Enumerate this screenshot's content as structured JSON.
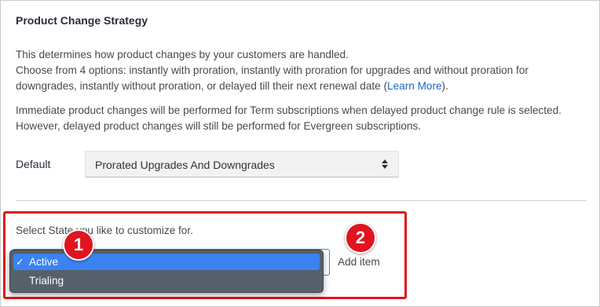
{
  "section": {
    "title": "Product Change Strategy",
    "description_line1": "This determines how product changes by your customers are handled.",
    "description_line2_pre": "Choose from 4 options: instantly with proration, instantly with proration for upgrades and without proration for downgrades, instantly without proration, or delayed till their next renewal date (",
    "learn_more": "Learn More",
    "description_line2_post": ").",
    "note": "Immediate product changes will be performed for Term subscriptions when delayed product change rule is selected. However, delayed product changes will still be performed for Evergreen subscriptions."
  },
  "default_field": {
    "label": "Default",
    "value": "Prorated Upgrades And Downgrades",
    "icon": "up-down-arrows-icon"
  },
  "state_customization": {
    "label": "Select State you like to customize for.",
    "add_item": "Add item",
    "dropdown": {
      "options": [
        {
          "label": "Active",
          "selected": true,
          "check": "✓"
        },
        {
          "label": "Trialing",
          "selected": false
        }
      ]
    }
  },
  "annotations": {
    "badge1": "1",
    "badge2": "2",
    "highlight_color": "#e0141e"
  },
  "colors": {
    "link": "#1a66c2",
    "dropdown_bg": "#55606a",
    "selected_option": "#3b83f0"
  }
}
